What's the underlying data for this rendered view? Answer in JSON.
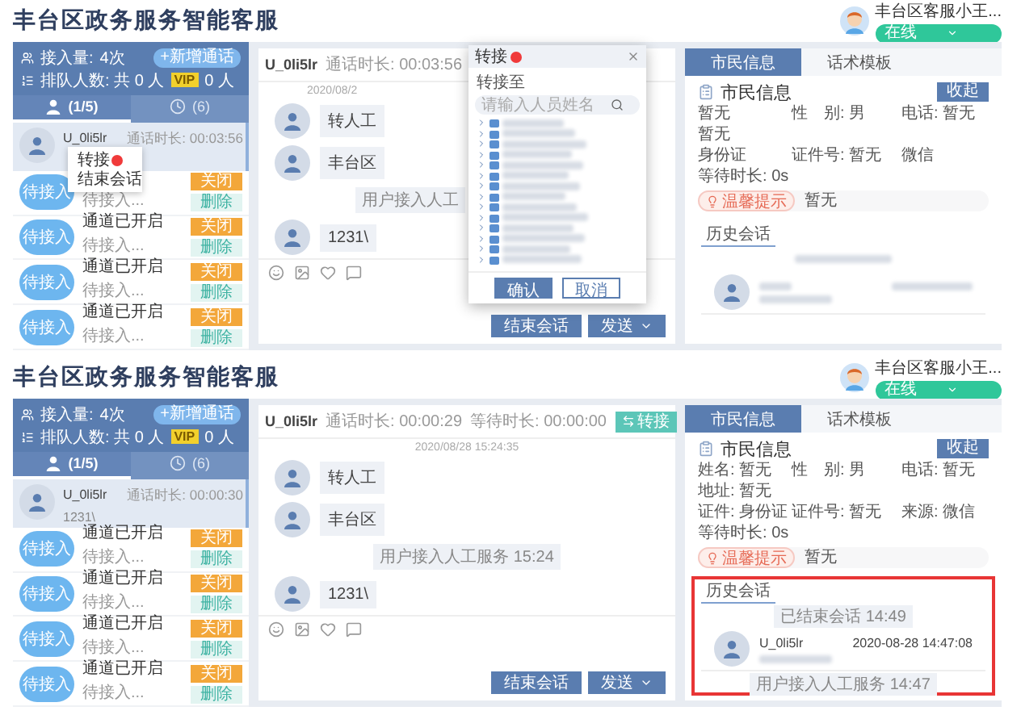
{
  "screens": [
    {
      "title": "丰台区政务服务智能客服",
      "agent": {
        "name": "丰台区客服小王...",
        "status": "在线"
      },
      "stats": {
        "access_label": "接入量:",
        "access_value": "4次",
        "new_call": "+新增通话",
        "queue": "排队人数: 共 0 人",
        "vip": "VIP",
        "vip_count": "0 人"
      },
      "list_tabs": [
        {
          "label": "(1/5)",
          "kind": "person",
          "selected": true
        },
        {
          "label": "(6)",
          "kind": "clock",
          "selected": false
        }
      ],
      "active_session": {
        "name": "U_0li5lr",
        "duration": "通话时长: 00:03:56"
      },
      "waiting": [
        {
          "avatar": "待接入",
          "status": "待接入...",
          "close": "关闭",
          "delete": "删除"
        },
        {
          "avatar": "待接入",
          "name": "通道已开启",
          "status": "待接入...",
          "close": "关闭",
          "delete": "删除"
        },
        {
          "avatar": "待接入",
          "name": "通道已开启",
          "status": "待接入...",
          "close": "关闭",
          "delete": "删除"
        },
        {
          "avatar": "待接入",
          "name": "通道已开启",
          "status": "待接入...",
          "close": "关闭",
          "delete": "删除"
        }
      ],
      "context_menu": {
        "items": [
          {
            "label": "转接",
            "badge": true
          },
          {
            "label": "结束会话",
            "badge": false
          }
        ]
      },
      "chat": {
        "user": "U_0li5lr",
        "duration": "通话时长: 00:03:56",
        "date": "2020/08/2",
        "messages": [
          {
            "kind": "user",
            "text": "转人工"
          },
          {
            "kind": "user",
            "text": "丰台区"
          },
          {
            "kind": "system",
            "text": "用户接入人工"
          },
          {
            "kind": "user",
            "text": "1231\\"
          }
        ],
        "end": "结束会话",
        "send": "发送"
      },
      "transfer_dialog": {
        "title": "转接",
        "badge": true,
        "target_label": "转接至",
        "placeholder": "请输入人员姓名",
        "tree_items": [
          {
            "kind": "redacted"
          },
          {
            "kind": "redacted"
          },
          {
            "kind": "redacted"
          },
          {
            "kind": "redacted"
          },
          {
            "kind": "redacted"
          },
          {
            "kind": "redacted"
          },
          {
            "kind": "redacted"
          },
          {
            "kind": "redacted"
          },
          {
            "kind": "redacted"
          },
          {
            "kind": "redacted"
          },
          {
            "kind": "redacted"
          },
          {
            "kind": "redacted"
          },
          {
            "kind": "redacted"
          },
          {
            "kind": "redacted"
          }
        ],
        "confirm": "确认",
        "cancel": "取消"
      },
      "right_tabs": [
        {
          "label": "市民信息",
          "selected": true
        },
        {
          "label": "话术模板",
          "selected": false
        }
      ],
      "info": {
        "heading": "市民信息",
        "collapse": "收起",
        "fields": [
          {
            "value": "暂无"
          },
          {
            "label": "性　别:",
            "value": "男"
          },
          {
            "label": "电话:",
            "value": "暂无"
          },
          {
            "value": "暂无"
          },
          {
            "value": "身份证"
          },
          {
            "label": "证件号:",
            "value": "暂无"
          },
          {
            "value": "微信"
          },
          {
            "label": "等待时长:",
            "value": "0s"
          }
        ],
        "hint_label": "温馨提示",
        "hint_value": "暂无"
      },
      "history": {
        "title": "历史会话",
        "highlighted": false,
        "entries": [
          {
            "kind": "divider"
          },
          {
            "kind": "message"
          }
        ]
      }
    },
    {
      "title": "丰台区政务服务智能客服",
      "agent": {
        "name": "丰台区客服小王...",
        "status": "在线"
      },
      "stats": {
        "access_label": "接入量:",
        "access_value": "4次",
        "new_call": "+新增通话",
        "queue": "排队人数: 共 0 人",
        "vip": "VIP",
        "vip_count": "0 人"
      },
      "list_tabs": [
        {
          "label": "(1/5)",
          "kind": "person",
          "selected": true
        },
        {
          "label": "(6)",
          "kind": "clock",
          "selected": false
        }
      ],
      "active_session": {
        "name": "U_0li5lr",
        "duration": "通话时长: 00:00:30",
        "preview": "1231\\"
      },
      "waiting": [
        {
          "avatar": "待接入",
          "name": "通道已开启",
          "status": "待接入...",
          "close": "关闭",
          "delete": "删除"
        },
        {
          "avatar": "待接入",
          "name": "通道已开启",
          "status": "待接入...",
          "close": "关闭",
          "delete": "删除"
        },
        {
          "avatar": "待接入",
          "name": "通道已开启",
          "status": "待接入...",
          "close": "关闭",
          "delete": "删除"
        },
        {
          "avatar": "待接入",
          "name": "通道已开启",
          "status": "待接入...",
          "close": "关闭",
          "delete": "删除"
        }
      ],
      "chat": {
        "user": "U_0li5lr",
        "duration": "通话时长: 00:00:29",
        "wait": "等待时长: 00:00:00",
        "transfer": "转接",
        "date": "2020/08/28 15:24:35",
        "messages": [
          {
            "kind": "user",
            "text": "转人工"
          },
          {
            "kind": "user",
            "text": "丰台区"
          },
          {
            "kind": "system",
            "text": "用户接入人工服务 15:24"
          },
          {
            "kind": "user",
            "text": "1231\\"
          }
        ],
        "end": "结束会话",
        "send": "发送"
      },
      "right_tabs": [
        {
          "label": "市民信息",
          "selected": true
        },
        {
          "label": "话术模板",
          "selected": false
        }
      ],
      "info": {
        "heading": "市民信息",
        "collapse": "收起",
        "fields": [
          {
            "label": "姓名:",
            "value": "暂无"
          },
          {
            "label": "性　别:",
            "value": "男"
          },
          {
            "label": "电话:",
            "value": "暂无"
          },
          {
            "label": "地址:",
            "value": "暂无"
          },
          {
            "label": "证件:",
            "value": "身份证"
          },
          {
            "label": "证件号:",
            "value": "暂无"
          },
          {
            "label": "来源:",
            "value": "微信"
          },
          {
            "label": "等待时长:",
            "value": "0s"
          }
        ],
        "hint_label": "温馨提示",
        "hint_value": "暂无"
      },
      "history": {
        "title": "历史会话",
        "highlighted": true,
        "entries": [
          {
            "kind": "divider",
            "text": "已结束会话 14:49"
          },
          {
            "kind": "message",
            "name": "U_0li5lr",
            "time": "2020-08-28 14:47:08"
          },
          {
            "kind": "divider",
            "text": "用户接入人工服务 14:47"
          }
        ]
      }
    }
  ]
}
